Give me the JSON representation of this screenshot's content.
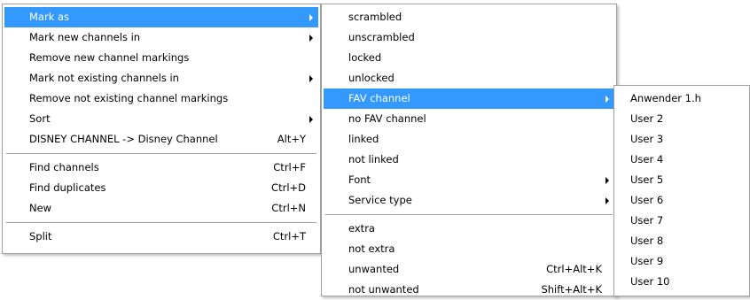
{
  "menu_main": {
    "items": [
      {
        "label": "Mark as",
        "shortcut": "",
        "submenu": true,
        "selected": true
      },
      {
        "label": "Mark new channels in",
        "shortcut": "",
        "submenu": true
      },
      {
        "label": "Remove new channel markings",
        "shortcut": ""
      },
      {
        "label": "Mark not existing channels in",
        "shortcut": "",
        "submenu": true
      },
      {
        "label": "Remove not existing channel markings",
        "shortcut": ""
      },
      {
        "label": "Sort",
        "shortcut": "",
        "submenu": true
      },
      {
        "label": "DISNEY CHANNEL -> Disney Channel",
        "shortcut": "Alt+Y"
      },
      {
        "label": "Find channels",
        "shortcut": "Ctrl+F"
      },
      {
        "label": "Find duplicates",
        "shortcut": "Ctrl+D"
      },
      {
        "label": "New",
        "shortcut": "Ctrl+N"
      },
      {
        "label": "Split",
        "shortcut": "Ctrl+T"
      }
    ]
  },
  "menu_mark_as": {
    "items": [
      {
        "label": "scrambled",
        "shortcut": ""
      },
      {
        "label": "unscrambled",
        "shortcut": ""
      },
      {
        "label": "locked",
        "shortcut": ""
      },
      {
        "label": "unlocked",
        "shortcut": ""
      },
      {
        "label": "FAV channel",
        "shortcut": "",
        "submenu": true,
        "selected": true
      },
      {
        "label": "no FAV channel",
        "shortcut": ""
      },
      {
        "label": "linked",
        "shortcut": ""
      },
      {
        "label": "not linked",
        "shortcut": ""
      },
      {
        "label": "Font",
        "shortcut": "",
        "submenu": true
      },
      {
        "label": "Service type",
        "shortcut": "",
        "submenu": true
      },
      {
        "label": "extra",
        "shortcut": ""
      },
      {
        "label": "not extra",
        "shortcut": ""
      },
      {
        "label": "unwanted",
        "shortcut": "Ctrl+Alt+K"
      },
      {
        "label": "not unwanted",
        "shortcut": "Shift+Alt+K"
      }
    ]
  },
  "menu_fav": {
    "items": [
      {
        "label": "Anwender 1.h"
      },
      {
        "label": "User 2"
      },
      {
        "label": "User 3"
      },
      {
        "label": "User 4"
      },
      {
        "label": "User 5"
      },
      {
        "label": "User 6"
      },
      {
        "label": "User 7"
      },
      {
        "label": "User 8"
      },
      {
        "label": "User 9"
      },
      {
        "label": "User 10"
      }
    ]
  },
  "colors": {
    "selection": "#3399ff",
    "border": "#a0a0a0"
  }
}
